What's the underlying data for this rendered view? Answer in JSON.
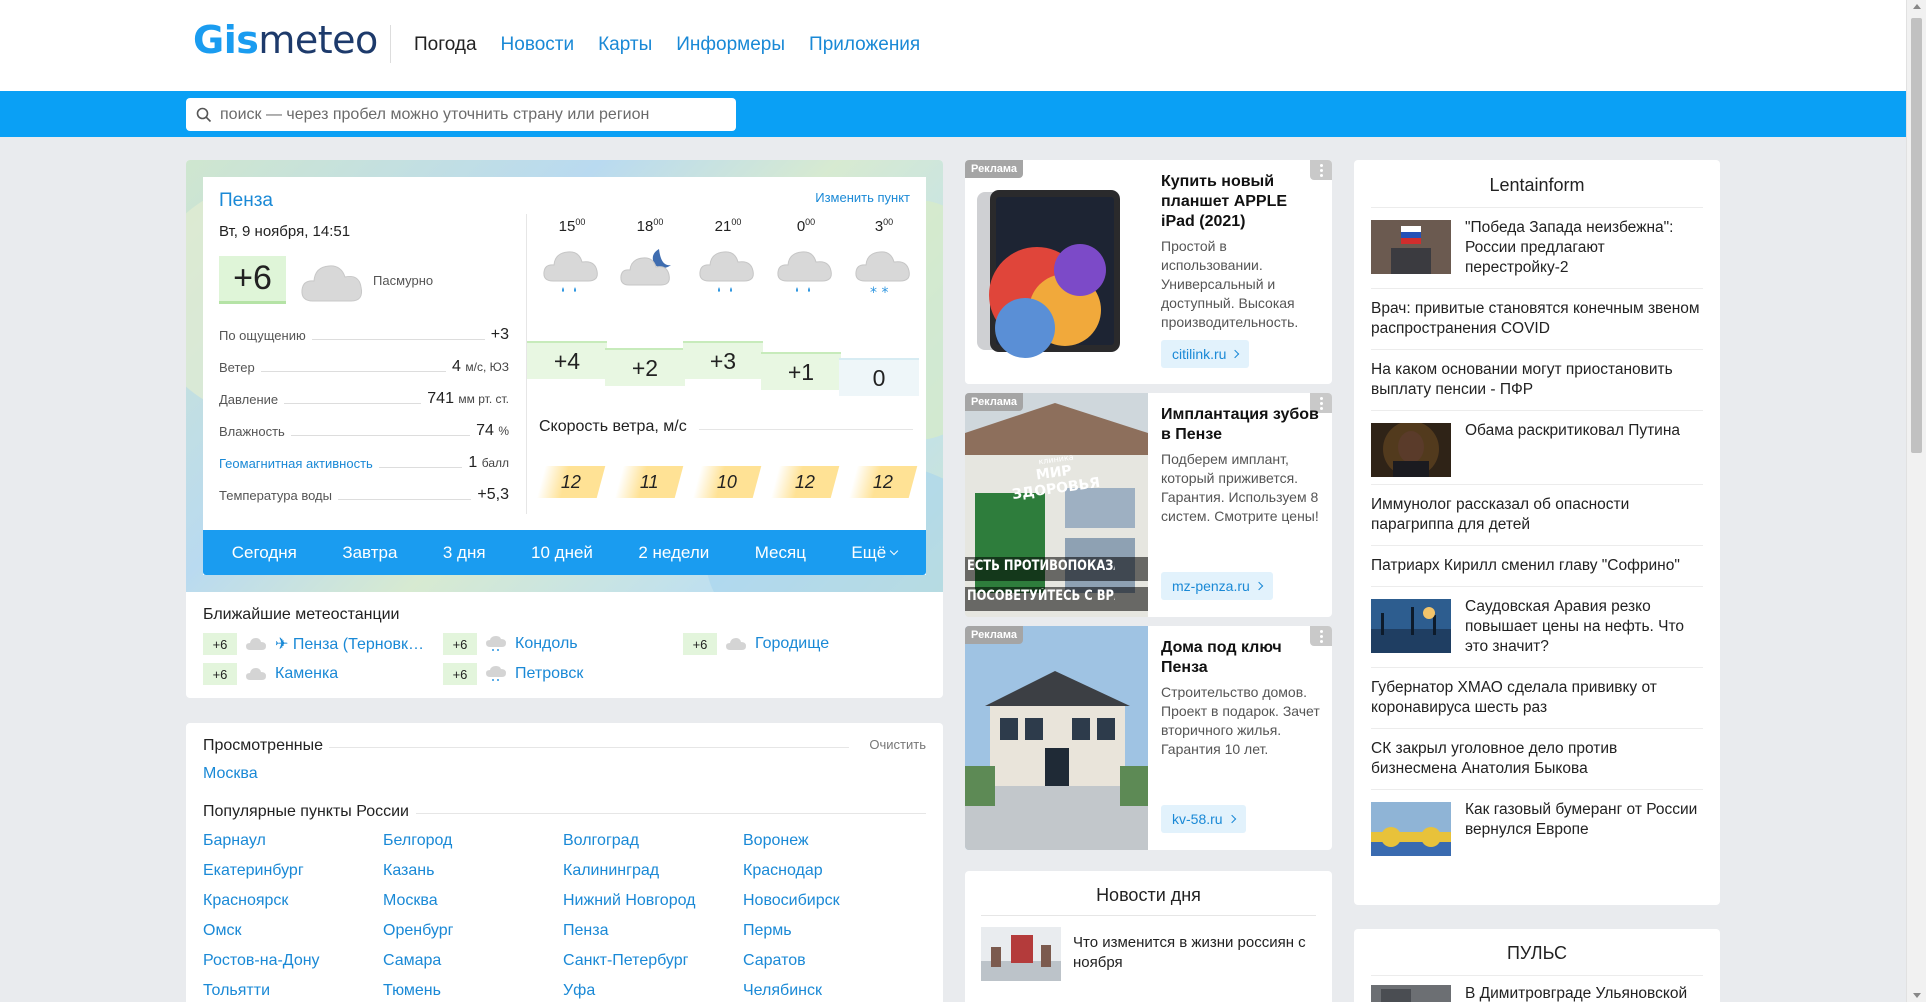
{
  "header": {
    "logo_part1": "Gis",
    "logo_part2": "meteo",
    "nav": [
      "Погода",
      "Новости",
      "Карты",
      "Информеры",
      "Приложения"
    ]
  },
  "search": {
    "placeholder": "поиск — через пробел можно уточнить страну или регион"
  },
  "weather": {
    "city": "Пенза",
    "change_point": "Изменить пункт",
    "date": "Вт, 9 ноября, 14:51",
    "temp_now": "+6",
    "condition": "Пасмурно",
    "params": [
      {
        "label": "По ощущению",
        "value": "+3",
        "unit": ""
      },
      {
        "label": "Ветер",
        "value": "4",
        "unit": "м/с, ЮЗ"
      },
      {
        "label": "Давление",
        "value": "741",
        "unit": "мм рт. ст."
      },
      {
        "label": "Влажность",
        "value": "74",
        "unit": "%"
      },
      {
        "label": "Геомагнитная активность",
        "value": "1",
        "unit": "балл"
      },
      {
        "label": "Температура воды",
        "value": "+5,3",
        "unit": ""
      }
    ],
    "hours": [
      {
        "h": "15",
        "m": "00",
        "temp": "+4",
        "wind": "12",
        "icon": "cloud-rain-icon"
      },
      {
        "h": "18",
        "m": "00",
        "temp": "+2",
        "wind": "11",
        "icon": "cloud-moon-icon"
      },
      {
        "h": "21",
        "m": "00",
        "temp": "+3",
        "wind": "10",
        "icon": "cloud-rain-icon"
      },
      {
        "h": "0",
        "m": "00",
        "temp": "+1",
        "wind": "12",
        "icon": "cloud-rain-icon"
      },
      {
        "h": "3",
        "m": "00",
        "temp": "0",
        "wind": "12",
        "icon": "cloud-snow-icon"
      }
    ],
    "wind_title": "Скорость ветра, м/с",
    "tabs": [
      "Сегодня",
      "Завтра",
      "3 дня",
      "10 дней",
      "2 недели",
      "Месяц",
      "Ещё"
    ],
    "stations_title": "Ближайшие метеостанции",
    "stations": [
      {
        "temp": "+6",
        "name": "✈ Пенза (Терновк…",
        "icon": "cloud-icon"
      },
      {
        "temp": "+6",
        "name": "Кондоль",
        "icon": "cloud-drizzle-icon"
      },
      {
        "temp": "+6",
        "name": "Городище",
        "icon": "cloud-icon"
      },
      {
        "temp": "+6",
        "name": "Каменка",
        "icon": "cloud-icon"
      },
      {
        "temp": "+6",
        "name": "Петровск",
        "icon": "cloud-drizzle-icon"
      }
    ]
  },
  "places": {
    "viewed_title": "Просмотренные",
    "clear": "Очистить",
    "viewed": [
      "Москва"
    ],
    "popular_title": "Популярные пункты России",
    "popular": [
      "Барнаул",
      "Белгород",
      "Волгоград",
      "Воронеж",
      "Екатеринбург",
      "Казань",
      "Калининград",
      "Краснодар",
      "Красноярск",
      "Москва",
      "Нижний Новгород",
      "Новосибирск",
      "Омск",
      "Оренбург",
      "Пенза",
      "Пермь",
      "Ростов-на-Дону",
      "Самара",
      "Санкт-Петербург",
      "Саратов",
      "Тольятти",
      "Тюмень",
      "Уфа",
      "Челябинск"
    ]
  },
  "ads": [
    {
      "tag": "Реклама",
      "title": "Купить новый планшет APPLE iPad (2021)",
      "desc": "Простой в использовании. Универсальный и доступный. Высокая производительность.",
      "button": "citilink.ru"
    },
    {
      "tag": "Реклама",
      "title": "Имплантация зубов в Пензе",
      "desc": "Подберем имплант, который приживется. Гарантия. Используем 8 систем. Смотрите цены!",
      "button": "mz-penza.ru",
      "img_text1": "ЕСТЬ ПРОТИВОПОКАЗАНИЯ",
      "img_text2": "ПОСОВЕТУЙТЕСЬ С ВРАЧОМ",
      "img_sign": "МИР ЗДОРОВЬЯ",
      "img_sign_small": "клиника"
    },
    {
      "tag": "Реклама",
      "title": "Дома под ключ Пенза",
      "desc": "Строительство домов. Проект в подарок. Зачет вторичного жилья. Гарантия 10 лет.",
      "button": "kv-58.ru"
    }
  ],
  "news_day": {
    "title": "Новости дня",
    "items": [
      {
        "text": "Что изменится в жизни россиян с ноября"
      }
    ]
  },
  "lenta": {
    "title": "Lentainform",
    "items": [
      {
        "text": "\"Победа Запада неизбежна\": России предлагают перестройку-2",
        "img": true
      },
      {
        "text": "Врач: привитые становятся конечным звеном распространения COVID",
        "img": false
      },
      {
        "text": "На каком основании могут приостановить выплату пенсии - ПФР",
        "img": false
      },
      {
        "text": "Обама раскритиковал Путина",
        "img": true
      },
      {
        "text": "Иммунолог рассказал об опасности парагриппа для детей",
        "img": false
      },
      {
        "text": "Патриарх Кирилл сменил главу \"Софрино\"",
        "img": false
      },
      {
        "text": "Саудовская Аравия резко повышает цены на нефть. Что это значит?",
        "img": true
      },
      {
        "text": "Губернатор ХМАО сделала прививку от коронавируса шесть раз",
        "img": false
      },
      {
        "text": "СК закрыл уголовное дело против бизнесмена Анатолия Быкова",
        "img": false
      },
      {
        "text": "Как газовый бумеранг от России вернулся Европе",
        "img": true
      }
    ]
  },
  "puls": {
    "title": "ПУЛЬС",
    "item": "В Димитровграде Ульяновской"
  },
  "colors": {
    "brand_blue": "#0aa0f5",
    "link": "#1a89d6",
    "temp_green": "#dff5d8",
    "wind_yellow": "#ffe295"
  }
}
